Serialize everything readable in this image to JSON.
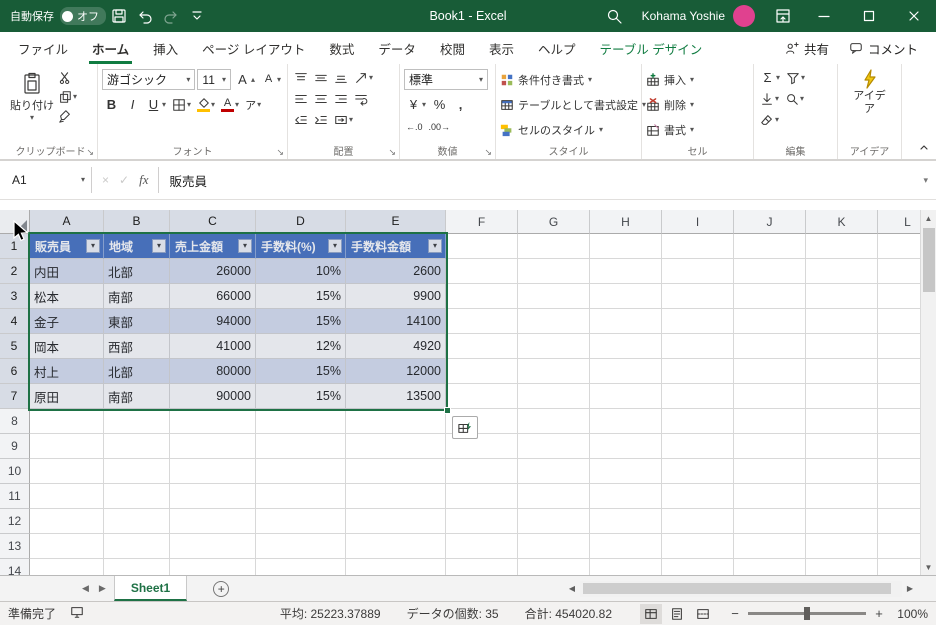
{
  "colors": {
    "titlebar_green": "#185C37",
    "accent_green": "#107C41",
    "table_header_blue": "#4472C4",
    "band_row_blue": "#D9E1F2",
    "selection_border_green": "#1E7145",
    "avatar_pink": "#E0418F"
  },
  "icons": {
    "caret": "▾",
    "caret_up": "▴",
    "bold": "B",
    "italic": "I",
    "underline": "U",
    "grow_letter": "A",
    "shrink_letter": "A",
    "sigma": "Σ",
    "percent": "%",
    "comma": ",",
    "currency": "¥",
    "phonetic": "ア",
    "dec_left": "←.0",
    "dec_right": ".00→",
    "cancel": "×",
    "enter": "✓",
    "fx": "fx",
    "launcher": "↘",
    "scroll_up": "▲",
    "scroll_down": "▼",
    "scroll_left": "◀",
    "scroll_right": "▶",
    "sheet_prev": "◀",
    "sheet_next": "▶",
    "add_sheet": "+",
    "zoom_out": "−",
    "zoom_in": "+"
  },
  "titlebar": {
    "autosave_label": "自動保存",
    "autosave_state": "オフ",
    "title": "Book1 - Excel",
    "user_name": "Kohama Yoshie"
  },
  "tabs": {
    "items": [
      {
        "label": "ファイル"
      },
      {
        "label": "ホーム",
        "active": true
      },
      {
        "label": "挿入"
      },
      {
        "label": "ページ レイアウト"
      },
      {
        "label": "数式"
      },
      {
        "label": "データ"
      },
      {
        "label": "校閲"
      },
      {
        "label": "表示"
      },
      {
        "label": "ヘルプ"
      },
      {
        "label": "テーブル デザイン",
        "contextual": true
      }
    ],
    "share": "共有",
    "comments": "コメント"
  },
  "ribbon": {
    "clipboard": {
      "group": "クリップボード",
      "paste": "貼り付け"
    },
    "font": {
      "group": "フォント",
      "name": "游ゴシック",
      "size": "11"
    },
    "alignment": {
      "group": "配置"
    },
    "number": {
      "group": "数値",
      "format": "標準"
    },
    "styles": {
      "group": "スタイル",
      "conditional": "条件付き書式",
      "format_table": "テーブルとして書式設定",
      "cell_styles": "セルのスタイル"
    },
    "cells": {
      "group": "セル",
      "insert": "挿入",
      "delete": "削除",
      "format": "書式"
    },
    "editing": {
      "group": "編集"
    },
    "ideas": {
      "group": "アイデア",
      "button": "アイデア"
    }
  },
  "formula_bar": {
    "name_box": "A1",
    "value": "販売員"
  },
  "grid": {
    "columns": [
      "A",
      "B",
      "C",
      "D",
      "E",
      "F",
      "G",
      "H",
      "I",
      "J",
      "K",
      "L"
    ],
    "row_numbers": [
      "1",
      "2",
      "3",
      "4",
      "5",
      "6",
      "7",
      "8",
      "9",
      "10",
      "11",
      "12",
      "13",
      "14"
    ],
    "table": {
      "headers": [
        "販売員",
        "地域",
        "売上金額",
        "手数料(%)",
        "手数料金額"
      ],
      "rows": [
        [
          "内田",
          "北部",
          "26000",
          "10%",
          "2600"
        ],
        [
          "松本",
          "南部",
          "66000",
          "15%",
          "9900"
        ],
        [
          "金子",
          "東部",
          "94000",
          "15%",
          "14100"
        ],
        [
          "岡本",
          "西部",
          "41000",
          "12%",
          "4920"
        ],
        [
          "村上",
          "北部",
          "80000",
          "15%",
          "12000"
        ],
        [
          "原田",
          "南部",
          "90000",
          "15%",
          "13500"
        ]
      ]
    }
  },
  "sheet_bar": {
    "active_tab": "Sheet1"
  },
  "status_bar": {
    "ready": "準備完了",
    "average": "平均: 25223.37889",
    "count": "データの個数: 35",
    "sum": "合計: 454020.82",
    "zoom": "100%"
  }
}
